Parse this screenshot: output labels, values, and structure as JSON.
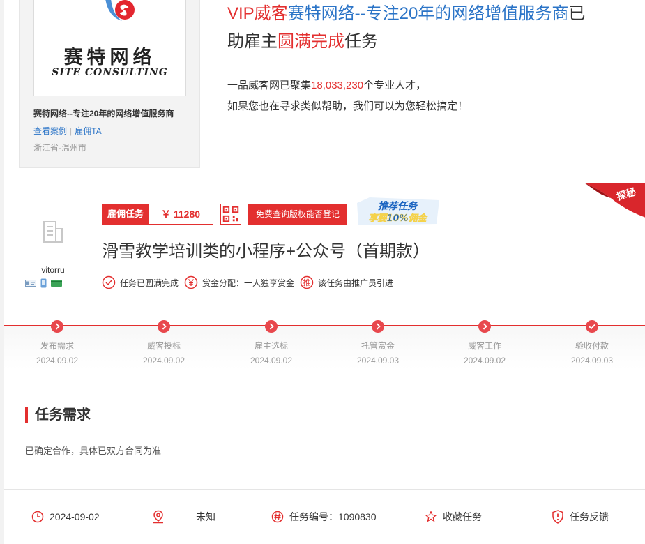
{
  "company_card": {
    "logo_cn": "赛特网络",
    "logo_en": "SITE CONSULTING",
    "name": "赛特网络--专注20年的网络增值服务商",
    "link_cases": "查看案例",
    "link_separator": "|",
    "link_hire": "雇佣TA",
    "location": "浙江省-温州市"
  },
  "vip": {
    "prefix": "VIP威客",
    "company": "赛特网络--专注20年的网络增值服务商",
    "suffix1": "已",
    "suffix2": "助雇主",
    "highlight": "圆满完成",
    "suffix3": "任务",
    "desc_prefix": "一品威客网已聚集",
    "talent_count": "18,033,230",
    "desc_suffix": "个专业人才，",
    "desc_line2": "如果您也在寻求类似帮助，我们可以为您轻松搞定！"
  },
  "corner_ribbon": "探秘",
  "employer": {
    "username": "vitorru"
  },
  "task": {
    "type_label": "雇佣任务",
    "price": "￥ 11280",
    "copyright_button": "免费查询版权能否登记",
    "promo_line1": "推荐任务",
    "promo_line2": "享要10%佣金",
    "title": "滑雪教学培训类的小程序+公众号（首期款）",
    "meta": [
      {
        "icon": "check-circle-icon",
        "text": "任务已圆满完成"
      },
      {
        "icon": "yen-circle-icon",
        "text": "赏金分配：一人独享赏金"
      },
      {
        "icon": "promote-icon",
        "icon_text": "推",
        "text": "该任务由推广员引进"
      }
    ]
  },
  "progress": {
    "steps": [
      {
        "name": "发布需求",
        "date": "2024.09.02"
      },
      {
        "name": "威客投标",
        "date": "2024.09.02"
      },
      {
        "name": "雇主选标",
        "date": "2024.09.02"
      },
      {
        "name": "托管赏金",
        "date": "2024.09.03"
      },
      {
        "name": "威客工作",
        "date": "2024.09.02"
      },
      {
        "name": "验收付款",
        "date": "2024.09.03"
      }
    ]
  },
  "requirement": {
    "heading": "任务需求",
    "text": "已确定合作，具体已双方合同为准"
  },
  "footer": {
    "date": "2024-09-02",
    "location": "未知",
    "task_number": "任务编号：1090830",
    "favorite": "收藏任务",
    "feedback": "任务反馈"
  },
  "colors": {
    "accent_red": "#e32f2f",
    "link_blue": "#2b74c7"
  }
}
